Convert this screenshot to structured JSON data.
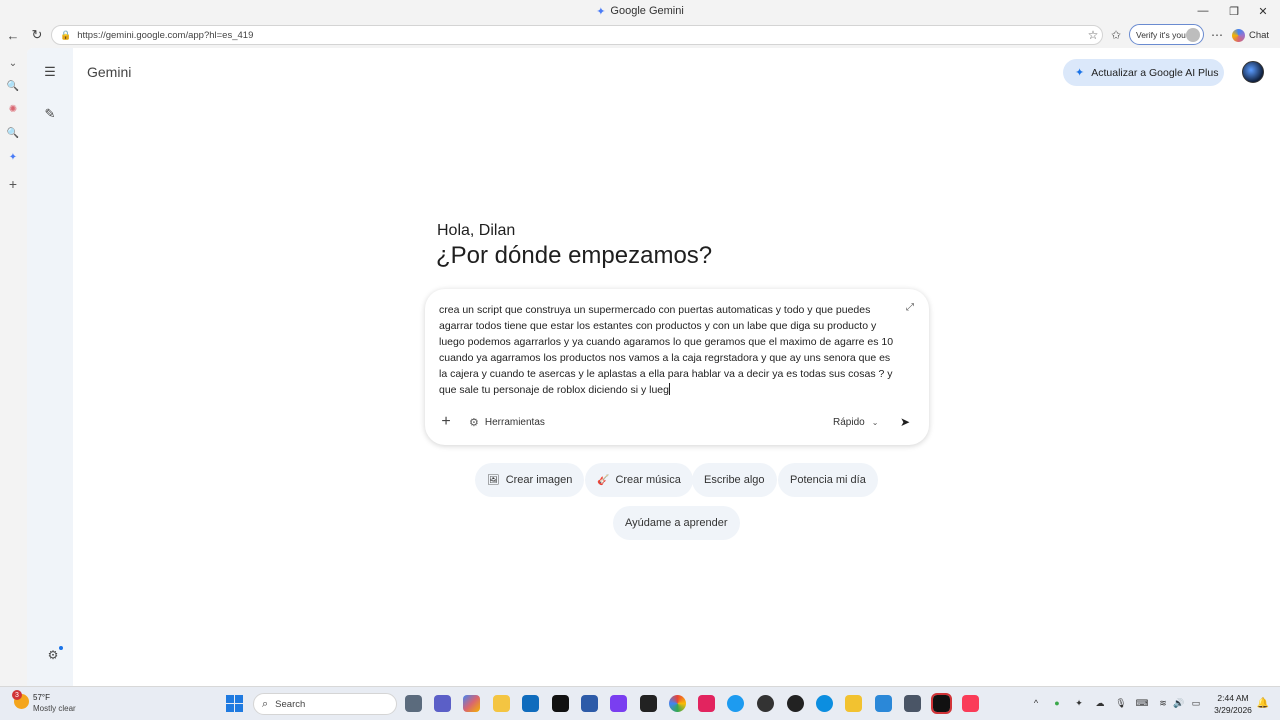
{
  "window": {
    "title": "Google Gemini",
    "controls": {
      "minimize": "—",
      "restore": "❐",
      "close": "✕"
    }
  },
  "browser": {
    "url": "https://gemini.google.com/app?hl=es_419",
    "verify_label": "Verify it's you",
    "chat_label": "Chat"
  },
  "gemini": {
    "brand": "Gemini",
    "upgrade_label": "Actualizar a Google AI Plus",
    "greeting": "Hola, Dilan",
    "headline": "¿Por dónde empezamos?",
    "prompt_text": "crea un script que construya un supermercado con puertas automaticas y todo y que puedes agarrar todos tiene que estar los estantes con productos y con un labe que diga su producto y luego podemos agarrarlos y ya cuando agaramos lo que geramos que el maximo de agarre es 10 cuando ya agarramos los productos nos vamos a la caja regrstadora y que ay uns senora que es la cajera y cuando te asercas y le aplastas a ella para hablar va a decir ya es todas sus cosas ? y que sale tu personaje de roblox diciendo si y lueg",
    "tools_label": "Herramientas",
    "mode_label": "Rápido",
    "chips": [
      {
        "icon": "🖼",
        "label": "Crear imagen"
      },
      {
        "icon": "🎸",
        "label": "Crear música"
      },
      {
        "icon": "",
        "label": "Escribe algo"
      },
      {
        "icon": "",
        "label": "Potencia mi día"
      },
      {
        "icon": "",
        "label": "Ayúdame a aprender"
      }
    ]
  },
  "taskbar": {
    "weather_temp": "57°F",
    "weather_desc": "Mostly clear",
    "weather_badge": "3",
    "search_label": "Search",
    "time": "2:44 AM",
    "date": "3/29/2026"
  },
  "colors": {
    "gemini_sidebar": "#f0f4f9",
    "upgrade_bg": "#dbe8fa",
    "accent_blue": "#1a73e8",
    "windows_blue": "#1f7ae0"
  }
}
